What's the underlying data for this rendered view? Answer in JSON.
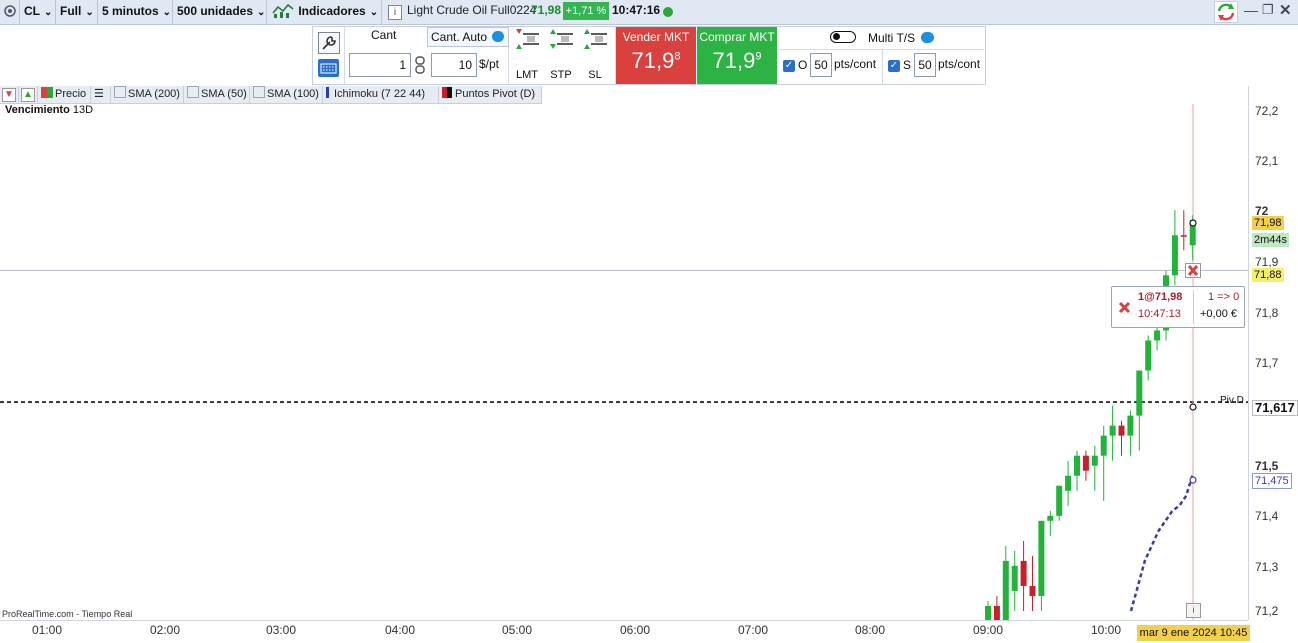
{
  "toolbar": {
    "symbol": "CL",
    "mode": "Full",
    "timeframe": "5 minutos",
    "units": "500 unidades",
    "indicators_label": "Indicadores",
    "instrument_name": "Light Crude Oil Full0224",
    "last_price": "71,98",
    "change_pct": "+1,71 %",
    "time": "10:47:16"
  },
  "ticket": {
    "cant_label": "Cant",
    "cant_value": "1",
    "cant_auto_label": "Cant. Auto",
    "per_point_value": "10",
    "per_point_unit": "$/pt",
    "lmt_label": "LMT",
    "stp_label": "STP",
    "sl_label": "SL",
    "sell_label": "Vender MKT",
    "sell_price_main": "71,9",
    "sell_price_sup": "8",
    "buy_label": "Comprar MKT",
    "buy_price_main": "71,9",
    "buy_price_sup": "9",
    "multi_ts_label": "Multi T/S",
    "o_label": "O",
    "o_value": "50",
    "s_label": "S",
    "s_value": "50",
    "pts_cont_label": "pts/cont"
  },
  "indicator_bar": {
    "price_label": "Precio",
    "sma200": "SMA (200)",
    "sma50": "SMA (50)",
    "sma100": "SMA (100)",
    "ichimoku": "Ichimoku (7 22 44)",
    "pivot": "Puntos Pivot (D)"
  },
  "chart": {
    "expiry_label": "Vencimiento",
    "expiry_value": "13D",
    "source_label": "ProRealTime.com - Tiempo Real",
    "pivot_label": "Piv D",
    "pivot_value": "71,617",
    "price_tag": "71,98",
    "timer_tag": "2m44s",
    "order_line_tag": "71,88",
    "ichimoku_tag": "71,475",
    "date_tag": "mar 9 ene 2024 10:45",
    "y_ticks": [
      "72,2",
      "72,1",
      "72",
      "71,9",
      "71,8",
      "71,7",
      "71,6",
      "71,5",
      "71,4",
      "71,3",
      "71,2"
    ],
    "x_ticks": [
      "01:00",
      "02:00",
      "03:00",
      "04:00",
      "05:00",
      "06:00",
      "07:00",
      "08:00",
      "09:00",
      "10:00"
    ]
  },
  "order_tooltip": {
    "fill": "1@71,98",
    "ratio": "1 => 0",
    "time": "10:47:13",
    "pnl": "+0,00 €"
  },
  "colors": {
    "up_candle": "#22b33a",
    "down_candle": "#c8202a",
    "sell": "#d9413f",
    "buy": "#2db344",
    "ichimoku_line": "#3a3aa8",
    "price_tag_bg": "#f2d04b",
    "timer_tag_bg": "#bfe8c3"
  },
  "chart_data": {
    "type": "candlestick",
    "y_range": [
      71.18,
      72.25
    ],
    "pivot_level": 71.617,
    "order_level": 71.88,
    "candles": [
      {
        "o": 71.18,
        "h": 71.22,
        "l": 71.18,
        "c": 71.21,
        "up": true
      },
      {
        "o": 71.21,
        "h": 71.23,
        "l": 71.18,
        "c": 71.18,
        "up": false
      },
      {
        "o": 71.18,
        "h": 71.33,
        "l": 71.18,
        "c": 71.3,
        "up": true
      },
      {
        "o": 71.24,
        "h": 71.32,
        "l": 71.2,
        "c": 71.29,
        "up": true
      },
      {
        "o": 71.3,
        "h": 71.34,
        "l": 71.2,
        "c": 71.25,
        "up": false
      },
      {
        "o": 71.25,
        "h": 71.31,
        "l": 71.2,
        "c": 71.23,
        "up": false
      },
      {
        "o": 71.23,
        "h": 71.38,
        "l": 71.2,
        "c": 71.38,
        "up": true
      },
      {
        "o": 71.38,
        "h": 71.4,
        "l": 71.35,
        "c": 71.39,
        "up": true
      },
      {
        "o": 71.39,
        "h": 71.45,
        "l": 71.38,
        "c": 71.45,
        "up": true
      },
      {
        "o": 71.44,
        "h": 71.5,
        "l": 71.41,
        "c": 71.47,
        "up": true
      },
      {
        "o": 71.47,
        "h": 71.52,
        "l": 71.44,
        "c": 71.51,
        "up": true
      },
      {
        "o": 71.51,
        "h": 71.52,
        "l": 71.46,
        "c": 71.48,
        "up": false
      },
      {
        "o": 71.49,
        "h": 71.53,
        "l": 71.44,
        "c": 71.51,
        "up": true
      },
      {
        "o": 71.51,
        "h": 71.57,
        "l": 71.42,
        "c": 71.55,
        "up": true
      },
      {
        "o": 71.55,
        "h": 71.61,
        "l": 71.5,
        "c": 71.57,
        "up": true
      },
      {
        "o": 71.57,
        "h": 71.58,
        "l": 71.51,
        "c": 71.55,
        "up": false
      },
      {
        "o": 71.55,
        "h": 71.6,
        "l": 71.51,
        "c": 71.59,
        "up": true
      },
      {
        "o": 71.59,
        "h": 71.68,
        "l": 71.52,
        "c": 71.68,
        "up": true
      },
      {
        "o": 71.68,
        "h": 71.75,
        "l": 71.66,
        "c": 71.74,
        "up": true
      },
      {
        "o": 71.74,
        "h": 71.8,
        "l": 71.72,
        "c": 71.76,
        "up": true
      },
      {
        "o": 71.76,
        "h": 71.88,
        "l": 71.74,
        "c": 71.87,
        "up": true
      },
      {
        "o": 71.87,
        "h": 72.0,
        "l": 71.85,
        "c": 71.95,
        "up": true
      },
      {
        "o": 71.95,
        "h": 72.0,
        "l": 71.92,
        "c": 71.95,
        "up": false
      },
      {
        "o": 71.93,
        "h": 71.99,
        "l": 71.9,
        "c": 71.98,
        "up": true
      }
    ],
    "ichimoku": [
      {
        "t": 0,
        "v": 71.2
      },
      {
        "t": 1,
        "v": 71.25
      },
      {
        "t": 2,
        "v": 71.3
      },
      {
        "t": 3,
        "v": 71.33
      },
      {
        "t": 4,
        "v": 71.36
      },
      {
        "t": 5,
        "v": 71.38
      },
      {
        "t": 6,
        "v": 71.4
      },
      {
        "t": 7,
        "v": 71.41
      },
      {
        "t": 8,
        "v": 71.43
      },
      {
        "t": 9,
        "v": 71.475
      }
    ]
  }
}
